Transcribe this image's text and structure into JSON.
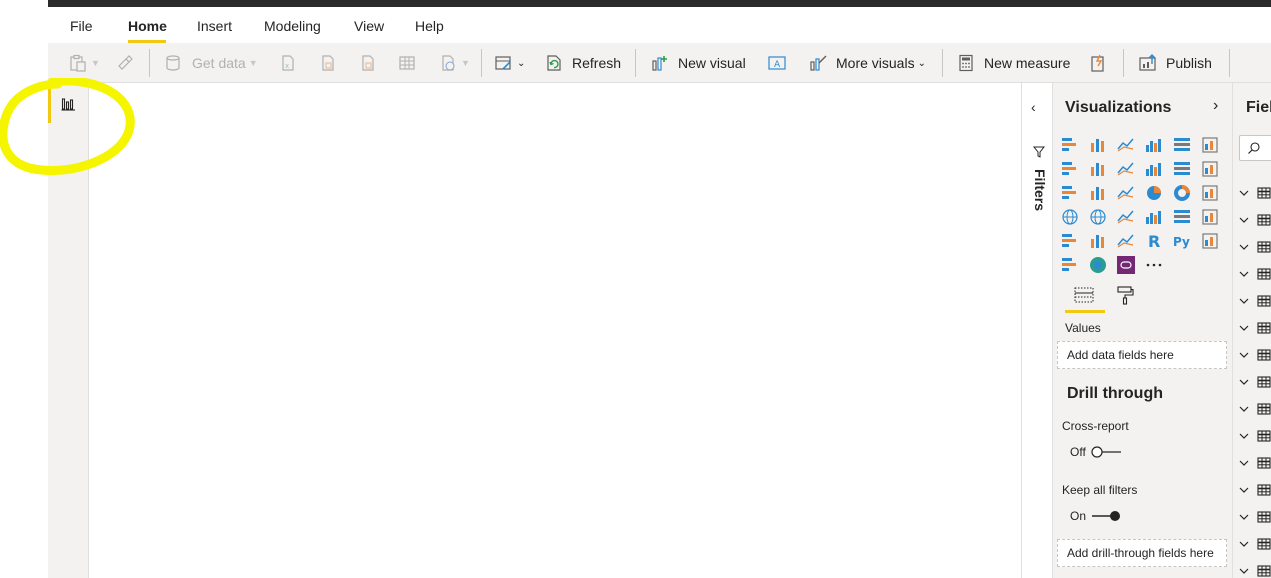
{
  "menu": {
    "file": "File",
    "home": "Home",
    "insert": "Insert",
    "modeling": "Modeling",
    "view": "View",
    "help": "Help"
  },
  "ribbon": {
    "get_data": "Get data",
    "refresh": "Refresh",
    "new_visual": "New visual",
    "more_visuals": "More visuals",
    "new_measure": "New measure",
    "publish": "Publish"
  },
  "filters_pane": {
    "label": "Filters"
  },
  "visualizations": {
    "title": "Visualizations",
    "values_label": "Values",
    "values_placeholder": "Add data fields here",
    "drill_through_title": "Drill through",
    "cross_report_label": "Cross-report",
    "cross_report_state": "Off",
    "keep_all_filters_label": "Keep all filters",
    "keep_all_filters_state": "On",
    "drill_placeholder": "Add drill-through fields here"
  },
  "fields_pane": {
    "title": "Fiel"
  },
  "colors": {
    "accent": "#f2c811",
    "highlight": "#f5f500",
    "viz_blue": "#2c8ad1",
    "viz_orange": "#e8873a"
  }
}
